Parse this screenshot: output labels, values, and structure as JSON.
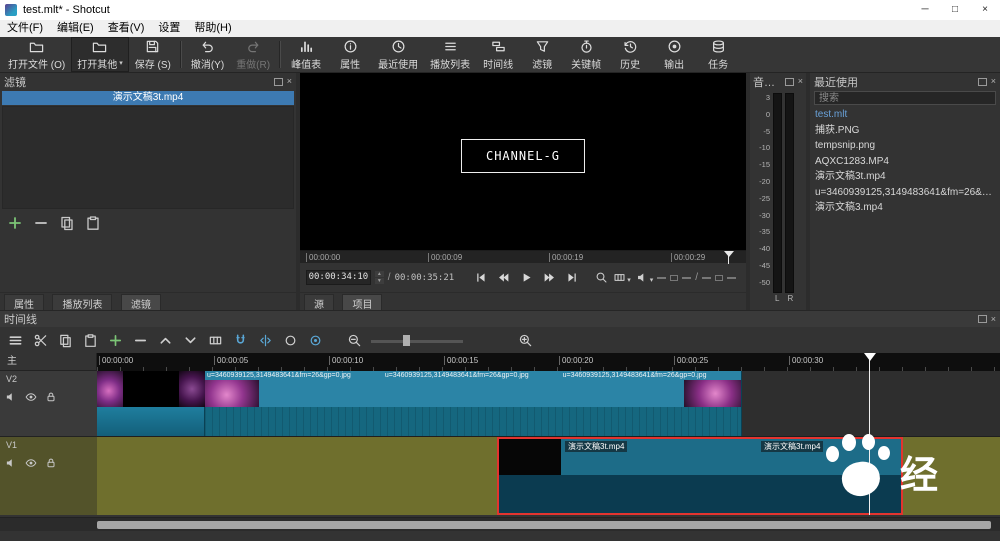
{
  "window": {
    "title": "test.mlt* - Shotcut",
    "controls": {
      "minimize": "─",
      "maximize": "□",
      "close": "×"
    }
  },
  "ui": {
    "caret": "▾",
    "close_glyph": "×",
    "spin_up": "▲",
    "spin_down": "▼"
  },
  "menu_items": [
    "文件(F)",
    "编辑(E)",
    "查看(V)",
    "设置",
    "帮助(H)"
  ],
  "toolbar": {
    "buttons": [
      {
        "label": "打开文件 (O)"
      },
      {
        "label": "打开其他"
      },
      {
        "label": "保存 (S)"
      },
      {
        "label": "撤消(Y)"
      },
      {
        "label": "重做(R)"
      },
      {
        "label": "峰值表"
      },
      {
        "label": "属性"
      },
      {
        "label": "最近使用"
      },
      {
        "label": "播放列表"
      },
      {
        "label": "时间线"
      },
      {
        "label": "滤镜"
      },
      {
        "label": "关键帧"
      },
      {
        "label": "历史"
      },
      {
        "label": "输出"
      },
      {
        "label": "任务"
      }
    ]
  },
  "filters_panel": {
    "title": "滤镜",
    "current_clip": "演示文稿3t.mp4"
  },
  "left_tabs": [
    "属性",
    "播放列表",
    "滤镜"
  ],
  "player": {
    "overlay": "CHANNEL-G",
    "ruler": [
      "00:00:00",
      "00:00:09",
      "00:00:19",
      "00:00:29"
    ],
    "position": "00:00:34:10",
    "time_sep": "/",
    "duration": "00:00:35:21"
  },
  "center_tabs": [
    "源",
    "项目"
  ],
  "audio_panel": {
    "title": "音…",
    "scale": [
      "3",
      "0",
      "-5",
      "-10",
      "-15",
      "-20",
      "-25",
      "-30",
      "-35",
      "-40",
      "-45",
      "-50"
    ],
    "channels": [
      "L",
      "R"
    ]
  },
  "recent": {
    "title": "最近使用",
    "search_placeholder": "搜索",
    "items": [
      "test.mlt",
      "捕获.PNG",
      "tempsnip.png",
      "AQXC1283.MP4",
      "演示文稿3t.mp4",
      "u=3460939125,3149483641&fm=26&gp…",
      "演示文稿3.mp4"
    ]
  },
  "timeline": {
    "title": "时间线",
    "master": "主",
    "ruler": [
      "00:00:00",
      "00:00:05",
      "00:00:10",
      "00:00:15",
      "00:00:20",
      "00:00:25",
      "00:00:30"
    ],
    "tracks": {
      "v2": "V2",
      "v1": "V1"
    },
    "clips": {
      "v2_label": "u=3460939125,3149483641&fm=26&gp=0.jpg",
      "v1_label": "演示文稿3t.mp4"
    }
  },
  "watermark": {
    "char": "经"
  }
}
